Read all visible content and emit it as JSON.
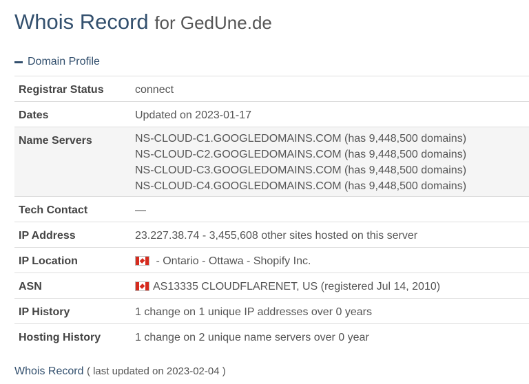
{
  "title": {
    "main": "Whois Record",
    "for_text": "for GedUne.de"
  },
  "section": {
    "label": "Domain Profile"
  },
  "profile": {
    "registrar_status": {
      "label": "Registrar Status",
      "value": "connect"
    },
    "dates": {
      "label": "Dates",
      "value": "Updated on 2023-01-17"
    },
    "name_servers": {
      "label": "Name Servers",
      "values": [
        "NS-CLOUD-C1.GOOGLEDOMAINS.COM (has 9,448,500 domains)",
        "NS-CLOUD-C2.GOOGLEDOMAINS.COM (has 9,448,500 domains)",
        "NS-CLOUD-C3.GOOGLEDOMAINS.COM (has 9,448,500 domains)",
        "NS-CLOUD-C4.GOOGLEDOMAINS.COM (has 9,448,500 domains)"
      ]
    },
    "tech_contact": {
      "label": "Tech Contact",
      "value": "—"
    },
    "ip_address": {
      "label": "IP Address",
      "value": "23.227.38.74 - 3,455,608 other sites hosted on this server"
    },
    "ip_location": {
      "label": "IP Location",
      "value": " - Ontario - Ottawa - Shopify Inc.",
      "flag": "canada-flag-icon"
    },
    "asn": {
      "label": "ASN",
      "value": "AS13335 CLOUDFLARENET, US (registered Jul 14, 2010)",
      "flag": "canada-flag-icon"
    },
    "ip_history": {
      "label": "IP History",
      "value": "1 change on 1 unique IP addresses over 0 years"
    },
    "hosting_history": {
      "label": "Hosting History",
      "value": "1 change on 2 unique name servers over 0 year"
    }
  },
  "footer": {
    "title": "Whois Record",
    "meta": "( last updated on 2023-02-04 )"
  },
  "colors": {
    "accent": "#33506e",
    "row_shade": "#f5f5f5",
    "border": "#dddddd"
  }
}
